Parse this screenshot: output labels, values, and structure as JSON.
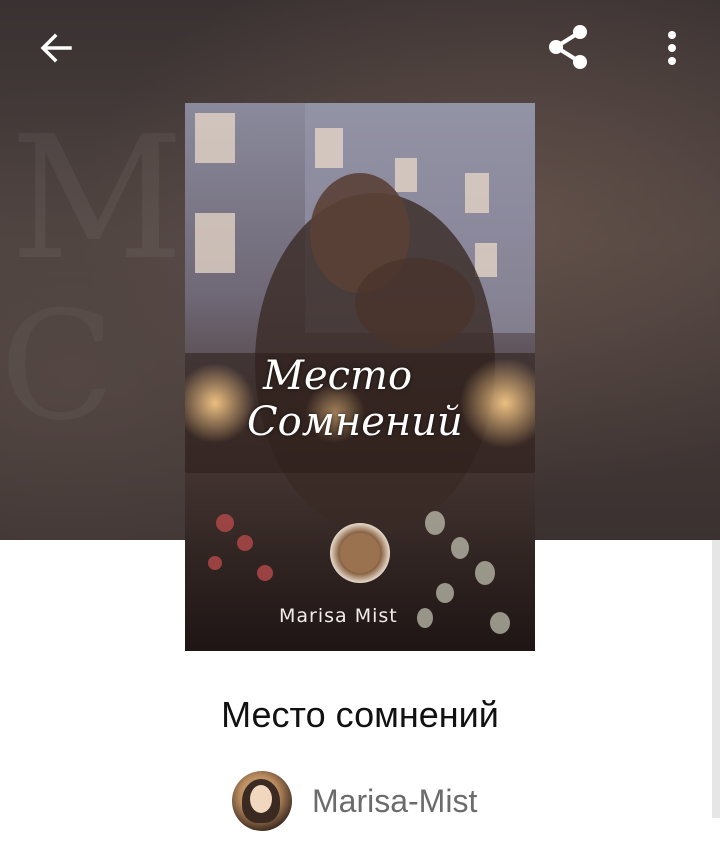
{
  "header": {
    "back_icon": "arrow-left-icon",
    "share_icon": "share-icon",
    "more_icon": "more-vertical-icon"
  },
  "cover": {
    "title_line1": "Место",
    "title_line2": "Сомнений",
    "author": "Marisa Mist"
  },
  "book": {
    "title": "Место сомнений"
  },
  "author": {
    "name": "Marisa-Mist",
    "avatar_icon": "avatar"
  },
  "colors": {
    "hero_bg": "#3f3533",
    "title_text": "#111111",
    "author_text": "#6b6b6b",
    "icon": "#ffffff"
  }
}
